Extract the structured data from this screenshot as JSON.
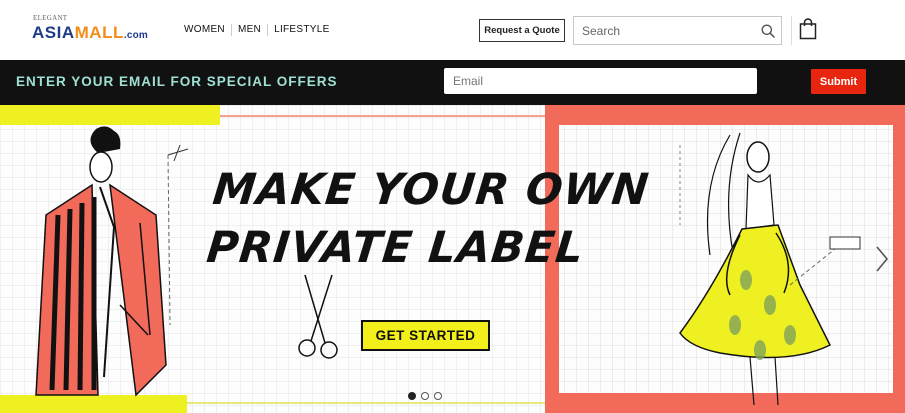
{
  "brand": {
    "small_text": "ELEGANT",
    "name_part1": "ASIA",
    "name_part2": "MALL",
    "name_part3": ".com"
  },
  "nav": {
    "items": [
      {
        "label": "WOMEN"
      },
      {
        "label": "MEN"
      },
      {
        "label": "LIFESTYLE"
      }
    ]
  },
  "header": {
    "quote_label": "Request a Quote",
    "search_placeholder": "Search"
  },
  "offer": {
    "text": "ENTER YOUR EMAIL FOR SPECIAL OFFERS",
    "email_placeholder": "Email",
    "submit_label": "Submit"
  },
  "hero": {
    "headline_line1": "MAKE YOUR OWN",
    "headline_line2": "PRIVATE LABEL",
    "cta_label": "GET STARTED",
    "slides": 3,
    "active_slide": 1
  },
  "icons": {
    "search": "search-icon",
    "bag": "shopping-bag-icon",
    "next": "chevron-right-icon",
    "scissors": "scissors-icon"
  },
  "colors": {
    "accent_teal": "#9ee0d4",
    "submit_red": "#e8250f",
    "cta_yellow": "#f2ef1a",
    "coral": "#f26a5a",
    "brand_blue": "#1f3c8a",
    "brand_orange": "#f28c1b"
  }
}
